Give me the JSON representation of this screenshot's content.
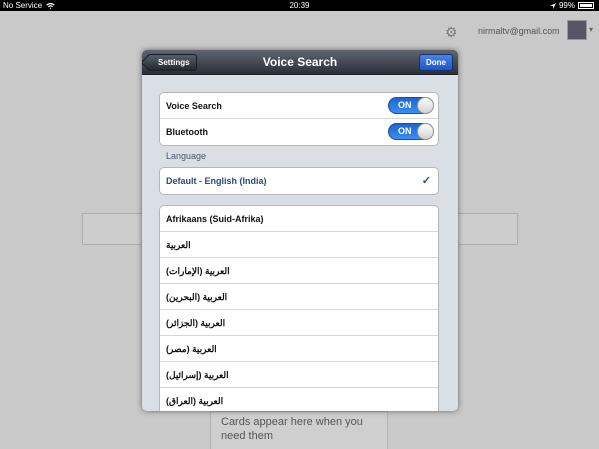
{
  "status_bar": {
    "carrier": "No Service",
    "time": "20:39",
    "battery": "99%"
  },
  "background": {
    "account_email": "nirmaltv@gmail.com",
    "card_text": "Cards appear here when you need them"
  },
  "modal": {
    "title": "Voice Search",
    "back_label": "Settings",
    "done_label": "Done",
    "toggles": [
      {
        "label": "Voice Search",
        "state": "ON"
      },
      {
        "label": "Bluetooth",
        "state": "ON"
      }
    ],
    "language_section_label": "Language",
    "selected_language": "Default - English (India)",
    "languages": [
      "Afrikaans (Suid-Afrika)",
      "العربية",
      "العربية (الإمارات)",
      "العربية (البحرين)",
      "العربية (الجزائر)",
      "العربية (مصر)",
      "العربية (إسرائيل)",
      "العربية (العراق)"
    ]
  },
  "colors": {
    "nav_bar": "#2a3038",
    "done_button": "#1c56c6",
    "toggle_on": "#2a78e4",
    "selected_text": "#2a4a7f"
  }
}
